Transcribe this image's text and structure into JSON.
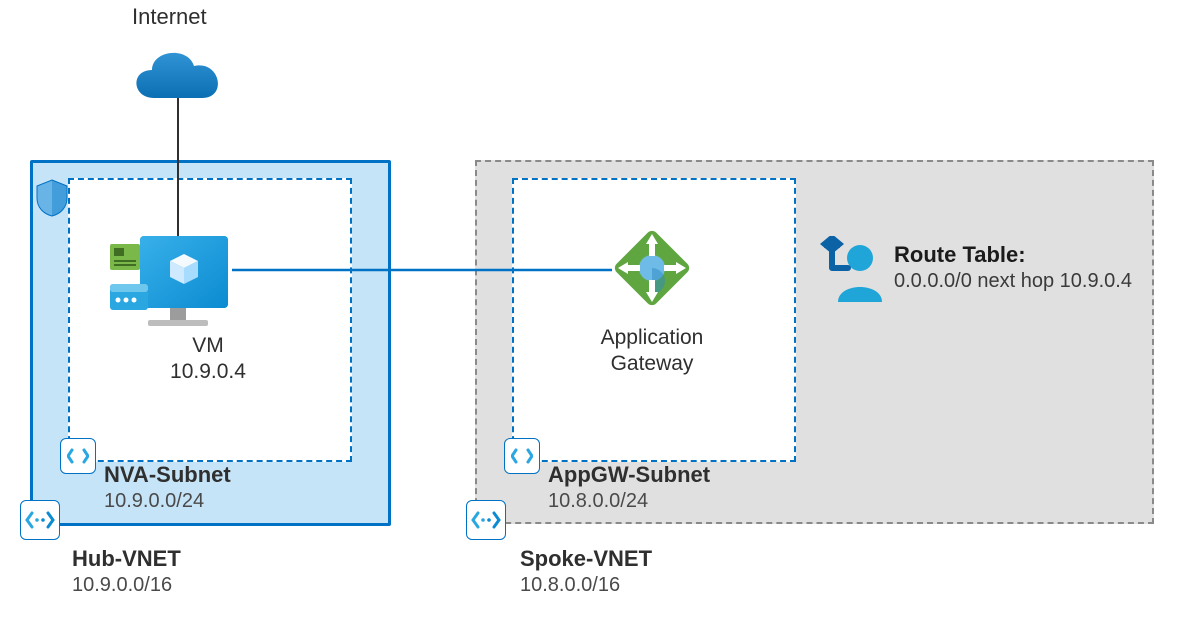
{
  "internet": {
    "label": "Internet"
  },
  "hub": {
    "vnet_name": "Hub-VNET",
    "vnet_cidr": "10.9.0.0/16",
    "subnet_name": "NVA-Subnet",
    "subnet_cidr": "10.9.0.0/24",
    "vm_label": "VM",
    "vm_ip": "10.9.0.4"
  },
  "spoke": {
    "vnet_name": "Spoke-VNET",
    "vnet_cidr": "10.8.0.0/16",
    "subnet_name": "AppGW-Subnet",
    "subnet_cidr": "10.8.0.0/24",
    "appgw_label_line1": "Application",
    "appgw_label_line2": "Gateway"
  },
  "route_table": {
    "title": "Route Table:",
    "rule": "0.0.0.0/0 next hop 10.9.0.4"
  },
  "colors": {
    "azure_blue": "#0072c6",
    "hub_fill": "#c6e4f7",
    "spoke_fill": "#e0e0e0",
    "green": "#5fa641"
  }
}
